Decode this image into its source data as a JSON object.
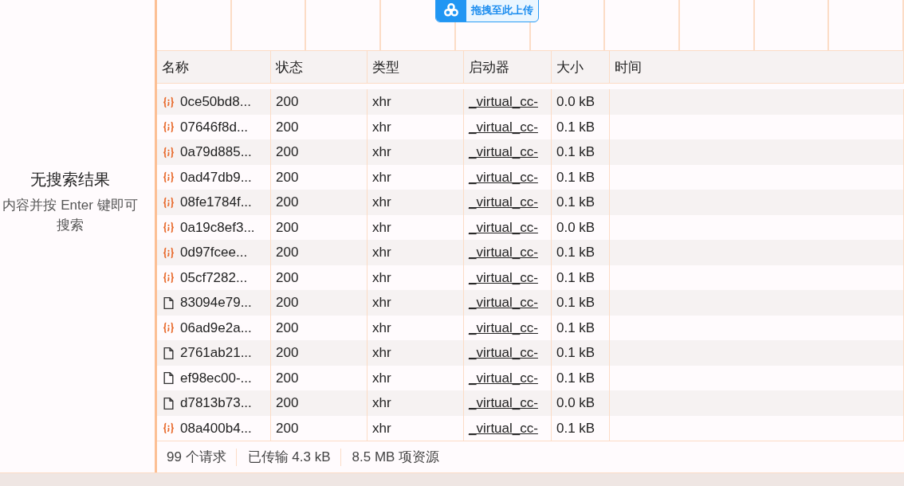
{
  "search_panel": {
    "title": "无搜索结果",
    "hint": "内容并按 Enter 键即可搜索"
  },
  "upload_badge": {
    "label": "拖拽至此上传"
  },
  "table": {
    "columns": [
      "名称",
      "状态",
      "类型",
      "启动器",
      "大小",
      "时间"
    ],
    "rows": [
      {
        "kind": "xhr",
        "name": "0ce50bd8...",
        "status": "200",
        "type": "xhr",
        "initiator": "_virtual_cc-",
        "size": "0.0 kB"
      },
      {
        "kind": "xhr",
        "name": "07646f8d...",
        "status": "200",
        "type": "xhr",
        "initiator": "_virtual_cc-",
        "size": "0.1 kB"
      },
      {
        "kind": "xhr",
        "name": "0a79d885...",
        "status": "200",
        "type": "xhr",
        "initiator": "_virtual_cc-",
        "size": "0.1 kB"
      },
      {
        "kind": "xhr",
        "name": "0ad47db9...",
        "status": "200",
        "type": "xhr",
        "initiator": "_virtual_cc-",
        "size": "0.1 kB"
      },
      {
        "kind": "xhr",
        "name": "08fe1784f...",
        "status": "200",
        "type": "xhr",
        "initiator": "_virtual_cc-",
        "size": "0.1 kB"
      },
      {
        "kind": "xhr",
        "name": "0a19c8ef3...",
        "status": "200",
        "type": "xhr",
        "initiator": "_virtual_cc-",
        "size": "0.0 kB"
      },
      {
        "kind": "xhr",
        "name": "0d97fcee...",
        "status": "200",
        "type": "xhr",
        "initiator": "_virtual_cc-",
        "size": "0.1 kB"
      },
      {
        "kind": "xhr",
        "name": "05cf7282...",
        "status": "200",
        "type": "xhr",
        "initiator": "_virtual_cc-",
        "size": "0.1 kB"
      },
      {
        "kind": "doc",
        "name": "83094e79...",
        "status": "200",
        "type": "xhr",
        "initiator": "_virtual_cc-",
        "size": "0.1 kB"
      },
      {
        "kind": "xhr",
        "name": "06ad9e2a...",
        "status": "200",
        "type": "xhr",
        "initiator": "_virtual_cc-",
        "size": "0.1 kB"
      },
      {
        "kind": "doc",
        "name": "2761ab21...",
        "status": "200",
        "type": "xhr",
        "initiator": "_virtual_cc-",
        "size": "0.1 kB"
      },
      {
        "kind": "doc",
        "name": "ef98ec00-...",
        "status": "200",
        "type": "xhr",
        "initiator": "_virtual_cc-",
        "size": "0.1 kB"
      },
      {
        "kind": "doc",
        "name": "d7813b73...",
        "status": "200",
        "type": "xhr",
        "initiator": "_virtual_cc-",
        "size": "0.0 kB"
      },
      {
        "kind": "xhr",
        "name": "08a400b4...",
        "status": "200",
        "type": "xhr",
        "initiator": "_virtual_cc-",
        "size": "0.1 kB"
      }
    ]
  },
  "status_bar": [
    "99 个请求",
    "已传输 4.3 kB",
    "8.5 MB 项资源"
  ]
}
